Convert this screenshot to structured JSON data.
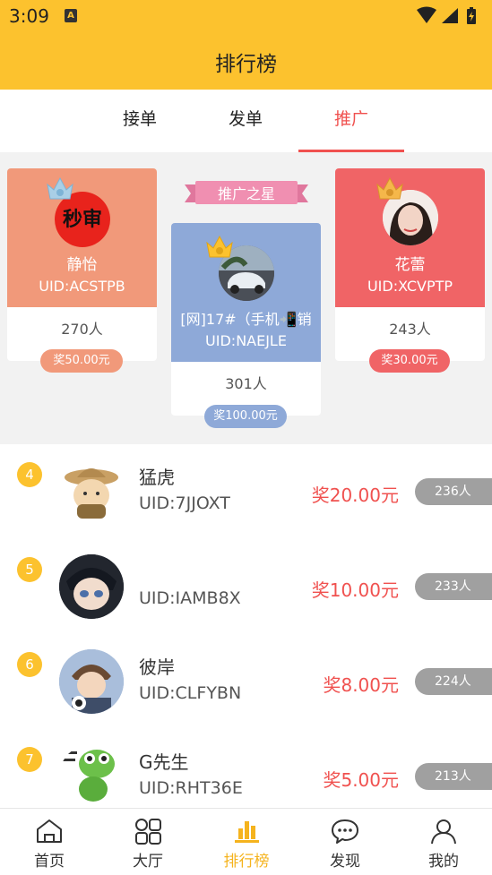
{
  "status_bar": {
    "time": "3:09",
    "app_icon": "A"
  },
  "header": {
    "title": "排行榜"
  },
  "tabs": [
    {
      "label": "接单"
    },
    {
      "label": "发单"
    },
    {
      "label": "推广",
      "active": true
    }
  ],
  "podium": {
    "banner": "推广之星",
    "second": {
      "name": "静怡",
      "uid": "UID:ACSTPB",
      "count": "270人",
      "reward": "奖50.00元",
      "avatar_text": "秒审",
      "crown_rank": "2"
    },
    "first": {
      "name": "[网]17#（手机📲销",
      "uid": "UID:NAEJLE",
      "count": "301人",
      "reward": "奖100.00元",
      "crown_rank": "1"
    },
    "third": {
      "name": "花蕾",
      "uid": "UID:XCVPTP",
      "count": "243人",
      "reward": "奖30.00元",
      "crown_rank": "3"
    }
  },
  "list": [
    {
      "rank": "4",
      "name": "猛虎",
      "uid": "UID:7JJOXT",
      "reward": "奖20.00元",
      "count": "236人"
    },
    {
      "rank": "5",
      "name": "",
      "uid": "UID:IAMB8X",
      "reward": "奖10.00元",
      "count": "233人"
    },
    {
      "rank": "6",
      "name": "彼岸",
      "uid": "UID:CLFYBN",
      "reward": "奖8.00元",
      "count": "224人"
    },
    {
      "rank": "7",
      "name": "G先生",
      "uid": "UID:RHT36E",
      "reward": "奖5.00元",
      "count": "213人"
    }
  ],
  "bottom_nav": [
    {
      "label": "首页",
      "icon": "home-icon"
    },
    {
      "label": "大厅",
      "icon": "grid-icon"
    },
    {
      "label": "排行榜",
      "icon": "ranking-icon",
      "active": true
    },
    {
      "label": "发现",
      "icon": "chat-icon"
    },
    {
      "label": "我的",
      "icon": "profile-icon"
    }
  ],
  "colors": {
    "header_bg": "#fcc22e",
    "accent_red": "#f0514f",
    "second_card": "#f1997a",
    "first_card": "#8ea9d8",
    "third_card": "#f06466",
    "nav_active": "#f5b31d"
  }
}
